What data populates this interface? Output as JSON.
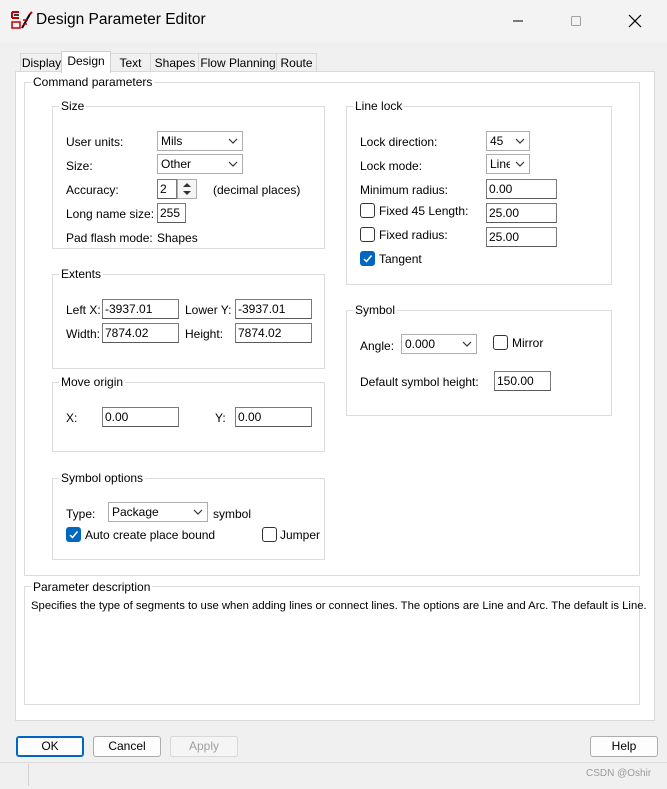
{
  "window": {
    "title": "Design Parameter Editor",
    "controls": [
      "minimize",
      "maximize",
      "close"
    ]
  },
  "tabs": [
    {
      "label": "Display"
    },
    {
      "label": "Design",
      "active": true
    },
    {
      "label": "Text"
    },
    {
      "label": "Shapes"
    },
    {
      "label": "Flow Planning"
    },
    {
      "label": "Route"
    }
  ],
  "command_parameters": {
    "label": "Command parameters",
    "size": {
      "label": "Size",
      "user_units_label": "User units:",
      "user_units_value": "Mils",
      "size_label": "Size:",
      "size_value": "Other",
      "accuracy_label": "Accuracy:",
      "accuracy_value": "2",
      "accuracy_suffix": "(decimal places)",
      "long_name_label": "Long name size:",
      "long_name_value": "255",
      "pad_flash_label": "Pad flash mode:",
      "pad_flash_value": "Shapes"
    },
    "extents": {
      "label": "Extents",
      "left_x_label": "Left X:",
      "left_x_value": "-3937.01",
      "lower_y_label": "Lower Y:",
      "lower_y_value": "-3937.01",
      "width_label": "Width:",
      "width_value": "7874.02",
      "height_label": "Height:",
      "height_value": "7874.02"
    },
    "move_origin": {
      "label": "Move origin",
      "x_label": "X:",
      "x_value": "0.00",
      "y_label": "Y:",
      "y_value": "0.00"
    },
    "symbol_options": {
      "label": "Symbol options",
      "type_label": "Type:",
      "type_value": "Package",
      "type_suffix": "symbol",
      "auto_create_label": "Auto create place bound",
      "auto_create_checked": true,
      "jumper_label": "Jumper",
      "jumper_checked": false
    },
    "line_lock": {
      "label": "Line lock",
      "lock_direction_label": "Lock direction:",
      "lock_direction_value": "45",
      "lock_mode_label": "Lock mode:",
      "lock_mode_value": "Line",
      "min_radius_label": "Minimum radius:",
      "min_radius_value": "0.00",
      "fixed45_label": "Fixed 45 Length:",
      "fixed45_checked": false,
      "fixed45_value": "25.00",
      "fixed_radius_label": "Fixed radius:",
      "fixed_radius_checked": false,
      "fixed_radius_value": "25.00",
      "tangent_label": "Tangent",
      "tangent_checked": true
    },
    "symbol": {
      "label": "Symbol",
      "angle_label": "Angle:",
      "angle_value": "0.000",
      "mirror_label": "Mirror",
      "mirror_checked": false,
      "default_height_label": "Default symbol height:",
      "default_height_value": "150.00"
    }
  },
  "parameter_description": {
    "label": "Parameter description",
    "text": "Specifies the type of segments to use when adding lines or connect lines. The options are Line and Arc. The default is Line."
  },
  "buttons": {
    "ok": "OK",
    "cancel": "Cancel",
    "apply": "Apply",
    "help": "Help"
  },
  "watermark": "CSDN @Oshir",
  "colors": {
    "accent": "#0067c0",
    "panel_bg": "#ffffff",
    "window_bg": "#f0f0f0"
  }
}
